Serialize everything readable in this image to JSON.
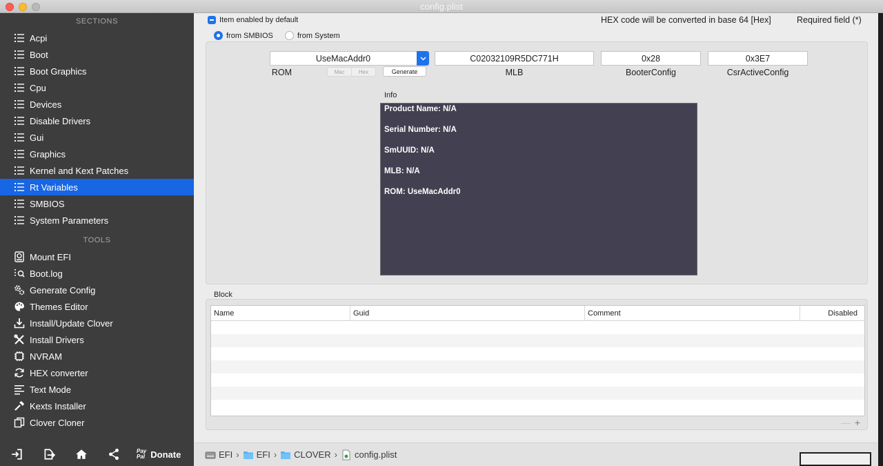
{
  "window": {
    "title": "config.plist"
  },
  "sidebar": {
    "sections_head": "SECTIONS",
    "tools_head": "TOOLS",
    "sections": [
      {
        "label": "Acpi"
      },
      {
        "label": "Boot"
      },
      {
        "label": "Boot Graphics"
      },
      {
        "label": "Cpu"
      },
      {
        "label": "Devices"
      },
      {
        "label": "Disable Drivers"
      },
      {
        "label": "Gui"
      },
      {
        "label": "Graphics"
      },
      {
        "label": "Kernel and Kext Patches"
      },
      {
        "label": "Rt Variables",
        "active": true
      },
      {
        "label": "SMBIOS"
      },
      {
        "label": "System Parameters"
      }
    ],
    "tools": [
      {
        "label": "Mount EFI",
        "icon": "disk-icon"
      },
      {
        "label": "Boot.log",
        "icon": "log-search-icon"
      },
      {
        "label": "Generate Config",
        "icon": "gears-icon"
      },
      {
        "label": "Themes Editor",
        "icon": "palette-icon"
      },
      {
        "label": "Install/Update Clover",
        "icon": "download-icon"
      },
      {
        "label": "Install Drivers",
        "icon": "tools-icon"
      },
      {
        "label": "NVRAM",
        "icon": "chip-icon"
      },
      {
        "label": "HEX converter",
        "icon": "refresh-icon"
      },
      {
        "label": "Text Mode",
        "icon": "text-icon"
      },
      {
        "label": "Kexts Installer",
        "icon": "hammer-icon"
      },
      {
        "label": "Clover Cloner",
        "icon": "copy-icon"
      }
    ],
    "footer": {
      "paypal_top": "Pay",
      "paypal_bottom": "Pal",
      "donate": "Donate"
    },
    "accent": "#1766e3"
  },
  "main": {
    "item_enabled": "Item enabled by default",
    "hex_note": "HEX code will be converted in base 64 [Hex]",
    "required": "Required field (*)",
    "radio_smbios": "from SMBIOS",
    "radio_system": "from System",
    "rom_value": "UseMacAddr0",
    "rom_label": "ROM",
    "seg_mac": "Mac",
    "seg_hex": "Hex",
    "generate": "Generate",
    "mlb_value": "C02032109R5DC771H",
    "mlb_label": "MLB",
    "booter_value": "0x28",
    "booter_label": "BooterConfig",
    "csr_value": "0x3E7",
    "csr_label": "CsrActiveConfig",
    "info_label": "Info",
    "info_lines": [
      "Product Name: N/A",
      "Serial Number: N/A",
      "SmUUID: N/A",
      "MLB: N/A",
      "ROM: UseMacAddr0"
    ],
    "block_label": "Block",
    "block_columns": [
      "Name",
      "Guid",
      "Comment",
      "Disabled"
    ],
    "minus": "—",
    "plus": "+"
  },
  "pathbar": {
    "crumbs": [
      "EFI",
      "EFI",
      "CLOVER",
      "config.plist"
    ],
    "sep": "›"
  }
}
